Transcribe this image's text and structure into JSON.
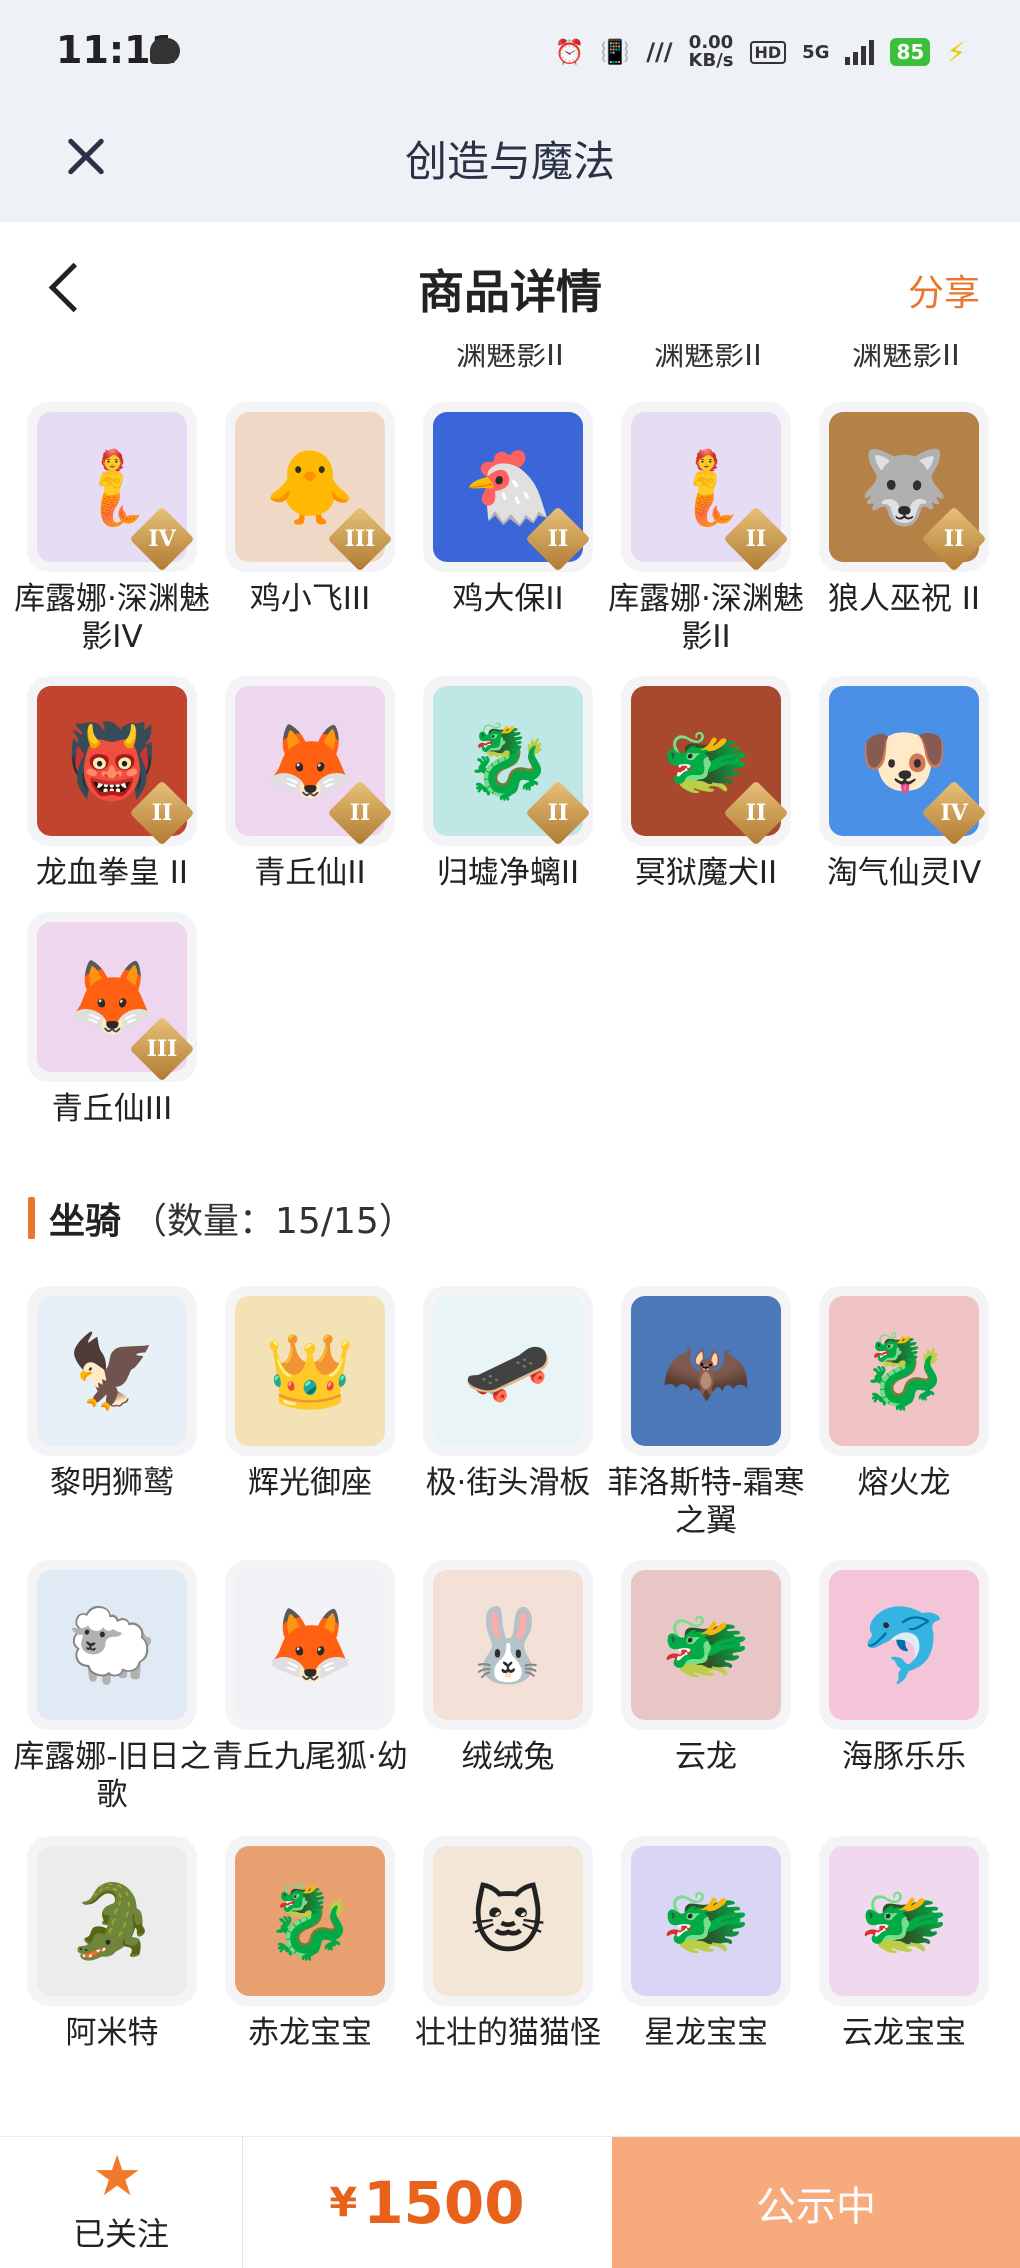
{
  "status_bar": {
    "time": "11:11",
    "speed": "0.00",
    "speed_unit": "KB/s",
    "hd": "HD",
    "network": "5G",
    "battery": "85"
  },
  "app": {
    "title": "创造与魔法"
  },
  "nav": {
    "title": "商品详情",
    "share": "分享"
  },
  "cut_labels": [
    "渊魅影II",
    "渊魅影II",
    "渊魅影II"
  ],
  "pets": [
    {
      "name": "库露娜·深渊魅影IV",
      "rank": "IV",
      "icon": "mermaid-girl-icon",
      "color": "#e6ddf5",
      "glyph": "🧜"
    },
    {
      "name": "鸡小飞III",
      "rank": "III",
      "icon": "chick-icon",
      "color": "#f0d8c6",
      "glyph": "🐥"
    },
    {
      "name": "鸡大保II",
      "rank": "II",
      "icon": "chicken-sunglasses-icon",
      "color": "#3a66d8",
      "glyph": "🐔"
    },
    {
      "name": "库露娜·深渊魅影II",
      "rank": "II",
      "icon": "mermaid-girl-icon",
      "color": "#e6ddf5",
      "glyph": "🧜"
    },
    {
      "name": "狼人巫祝 II",
      "rank": "II",
      "icon": "werewolf-icon",
      "color": "#b48246",
      "glyph": "🐺"
    },
    {
      "name": "龙血拳皇 II",
      "rank": "II",
      "icon": "dragon-boxer-icon",
      "color": "#c0442e",
      "glyph": "👹"
    },
    {
      "name": "青丘仙II",
      "rank": "II",
      "icon": "fox-fairy-icon",
      "color": "#eed6ee",
      "glyph": "🦊"
    },
    {
      "name": "归墟净螭II",
      "rank": "II",
      "icon": "water-dragon-icon",
      "color": "#bfe7e6",
      "glyph": "🐉"
    },
    {
      "name": "冥狱魔犬II",
      "rank": "II",
      "icon": "hell-hound-icon",
      "color": "#a8492e",
      "glyph": "🐲"
    },
    {
      "name": "淘气仙灵IV",
      "rank": "IV",
      "icon": "blue-puppy-icon",
      "color": "#4a90e6",
      "glyph": "🐶"
    },
    {
      "name": "青丘仙III",
      "rank": "III",
      "icon": "fox-fairy-icon",
      "color": "#eed6ee",
      "glyph": "🦊"
    }
  ],
  "mounts_section": {
    "title": "坐骑",
    "count": "（数量：15/15）"
  },
  "mounts": [
    {
      "name": "黎明狮鹫",
      "icon": "griffin-icon",
      "color": "#e6f0f6",
      "glyph": "🦅"
    },
    {
      "name": "辉光御座",
      "icon": "golden-throne-icon",
      "color": "#f3e2b6",
      "glyph": "👑"
    },
    {
      "name": "极·街头滑板",
      "icon": "skateboard-icon",
      "color": "#e8f4f6",
      "glyph": "🛹"
    },
    {
      "name": "菲洛斯特-霜寒之翼",
      "icon": "frost-wing-icon",
      "color": "#4a78b8",
      "glyph": "🦇"
    },
    {
      "name": "熔火龙",
      "icon": "lava-dragon-icon",
      "color": "#f0c4c4",
      "glyph": "🐉"
    },
    {
      "name": "库露娜-旧日之歌",
      "icon": "sheep-girl-icon",
      "color": "#dfeaf4",
      "glyph": "🐑"
    },
    {
      "name": "青丘九尾狐·幼",
      "icon": "nine-tail-fox-icon",
      "color": "#f2f2f6",
      "glyph": "🦊"
    },
    {
      "name": "绒绒兔",
      "icon": "fluffy-rabbit-icon",
      "color": "#f3e0d6",
      "glyph": "🐰"
    },
    {
      "name": "云龙",
      "icon": "cloud-dragon-icon",
      "color": "#e8c6c6",
      "glyph": "🐲"
    },
    {
      "name": "海豚乐乐",
      "icon": "dolphin-icon",
      "color": "#f4c4d8",
      "glyph": "🐬"
    },
    {
      "name": "阿米特",
      "icon": "crocodile-icon",
      "color": "#ececec",
      "glyph": "🐊"
    },
    {
      "name": "赤龙宝宝",
      "icon": "red-dragon-baby-icon",
      "color": "#e8a070",
      "glyph": "🐉"
    },
    {
      "name": "壮壮的猫猫怪",
      "icon": "cat-monster-icon",
      "color": "#f4e6d6",
      "glyph": "🐱"
    },
    {
      "name": "星龙宝宝",
      "icon": "star-dragon-baby-icon",
      "color": "#d8d6f4",
      "glyph": "🐲"
    },
    {
      "name": "云龙宝宝",
      "icon": "cloud-dragon-baby-icon",
      "color": "#f0d8ee",
      "glyph": "🐲"
    }
  ],
  "bottom": {
    "follow_label": "已关注",
    "currency": "¥",
    "price": "1500",
    "action": "公示中"
  }
}
